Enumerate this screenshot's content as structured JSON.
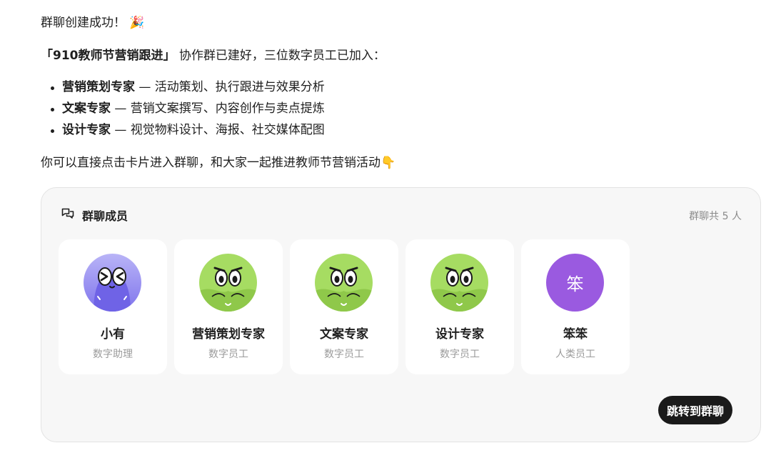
{
  "message": {
    "line1_text": "群聊创建成功！",
    "line1_emoji": "🎉",
    "group_name": "「910教师节营销跟进」",
    "line2_rest": " 协作群已建好，三位数字员工已加入：",
    "list": [
      {
        "name": "营销策划专家",
        "desc": " — 活动策划、执行跟进与效果分析"
      },
      {
        "name": "文案专家",
        "desc": " — 营销文案撰写、内容创作与卖点提炼"
      },
      {
        "name": "设计专家",
        "desc": " — 视觉物料设计、海报、社交媒体配图"
      }
    ],
    "line3_text": "你可以直接点击卡片进入群聊，和大家一起推进教师节营销活动",
    "line3_emoji": "👇"
  },
  "card": {
    "title": "群聊成员",
    "count": "群聊共 5 人",
    "button": "跳转到群聊",
    "members": [
      {
        "name": "小有",
        "role": "数字助理",
        "avatar": "xiaoyou-avatar"
      },
      {
        "name": "营销策划专家",
        "role": "数字员工",
        "avatar": "green-mascot-avatar"
      },
      {
        "name": "文案专家",
        "role": "数字员工",
        "avatar": "green-mascot-avatar"
      },
      {
        "name": "设计专家",
        "role": "数字员工",
        "avatar": "green-mascot-avatar"
      },
      {
        "name": "笨笨",
        "role": "人类员工",
        "avatar_text": "笨",
        "avatar_color": "#9a5ae0"
      }
    ]
  },
  "colors": {
    "text": "#1f1f1f",
    "muted": "#9b9b9b",
    "card_bg": "#f7f7f7",
    "button_bg": "#1a1a1a",
    "mascot_green": "#9ed35b",
    "assistant_purple": "#8f86f0"
  }
}
